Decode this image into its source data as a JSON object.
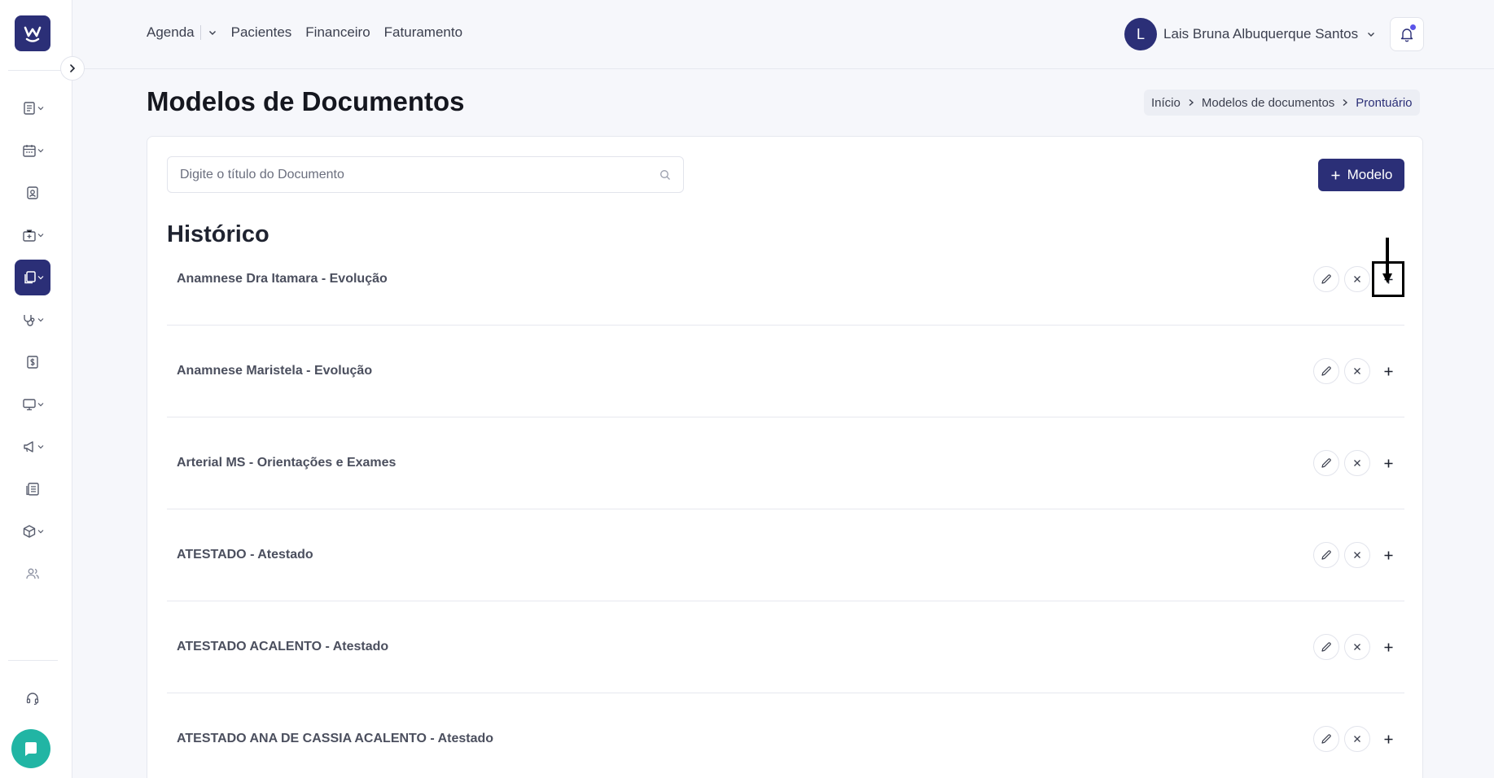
{
  "topnav": {
    "agenda": "Agenda",
    "pacientes": "Pacientes",
    "financeiro": "Financeiro",
    "faturamento": "Faturamento"
  },
  "user": {
    "initial": "L",
    "name": "Lais Bruna Albuquerque Santos"
  },
  "page": {
    "title": "Modelos de Documentos"
  },
  "breadcrumb": [
    "Início",
    "Modelos de documentos",
    "Prontuário"
  ],
  "search": {
    "placeholder": "Digite o título do Documento"
  },
  "buttons": {
    "add_model": "Modelo"
  },
  "section": {
    "title": "Histórico"
  },
  "documents": [
    "Anamnese Dra Itamara - Evolução",
    "Anamnese Maristela - Evolução",
    "Arterial MS - Orientações e Exames",
    "ATESTADO - Atestado",
    "ATESTADO ACALENTO - Atestado",
    "ATESTADO ANA DE CASSIA ACALENTO - Atestado"
  ],
  "sidebar": {
    "icons": [
      "records-icon",
      "calendar-icon",
      "patient-card-icon",
      "medical-bag-icon",
      "documents-icon",
      "stethoscope-icon",
      "dollar-icon",
      "monitor-icon",
      "megaphone-icon",
      "report-icon",
      "package-icon",
      "users-icon",
      "headset-icon",
      "chat-icon"
    ]
  },
  "colors": {
    "brand": "#2b2f77",
    "chat": "#21b5a4",
    "notification_dot": "#5b54e8"
  }
}
